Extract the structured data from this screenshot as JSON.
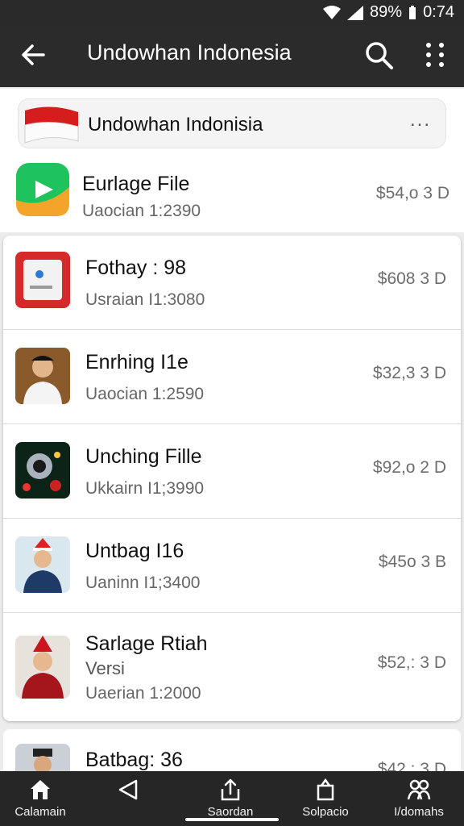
{
  "status": {
    "battery": "89%",
    "time": "0:74"
  },
  "header": {
    "title": "Undowhan Indonesia"
  },
  "banner": {
    "title": "Undowhan Indonisia",
    "more": "..."
  },
  "featured": {
    "name": "Eurlage File",
    "sub": "Uaocian 1:2390",
    "price": "$54,o 3 D"
  },
  "items": [
    {
      "name": "Fothay : 98",
      "sub": "Usraian I1:3080",
      "price": "$608 3 D"
    },
    {
      "name": "Enrhing I1e",
      "sub": "Uaocian 1:2590",
      "price": "$32,3 3 D"
    },
    {
      "name": "Unching Fille",
      "sub": "Ukkairn I1;3990",
      "price": "$92,o 2 D"
    },
    {
      "name": "Untbag I16",
      "sub": "Uaninn I1;3400",
      "price": "$45o 3 B"
    },
    {
      "name": "Sarlage Rtiah",
      "version": "Versi",
      "sub": "Uaerian 1:2000",
      "price": "$52,: 3 D"
    }
  ],
  "partial": {
    "name": "Batbag: 36",
    "price": "$42,: 3 D"
  },
  "bottom_nav": [
    {
      "label": "Calamain",
      "icon": "home-icon"
    },
    {
      "label": "",
      "icon": "back-triangle-icon"
    },
    {
      "label": "Saordan",
      "icon": "share-icon"
    },
    {
      "label": "Solpacio",
      "icon": "bag-icon"
    },
    {
      "label": "I/domahs",
      "icon": "people-icon"
    }
  ],
  "colors": {
    "app_bar": "#2b2b2b",
    "nav_bar": "#262626",
    "surface": "#ffffff"
  }
}
